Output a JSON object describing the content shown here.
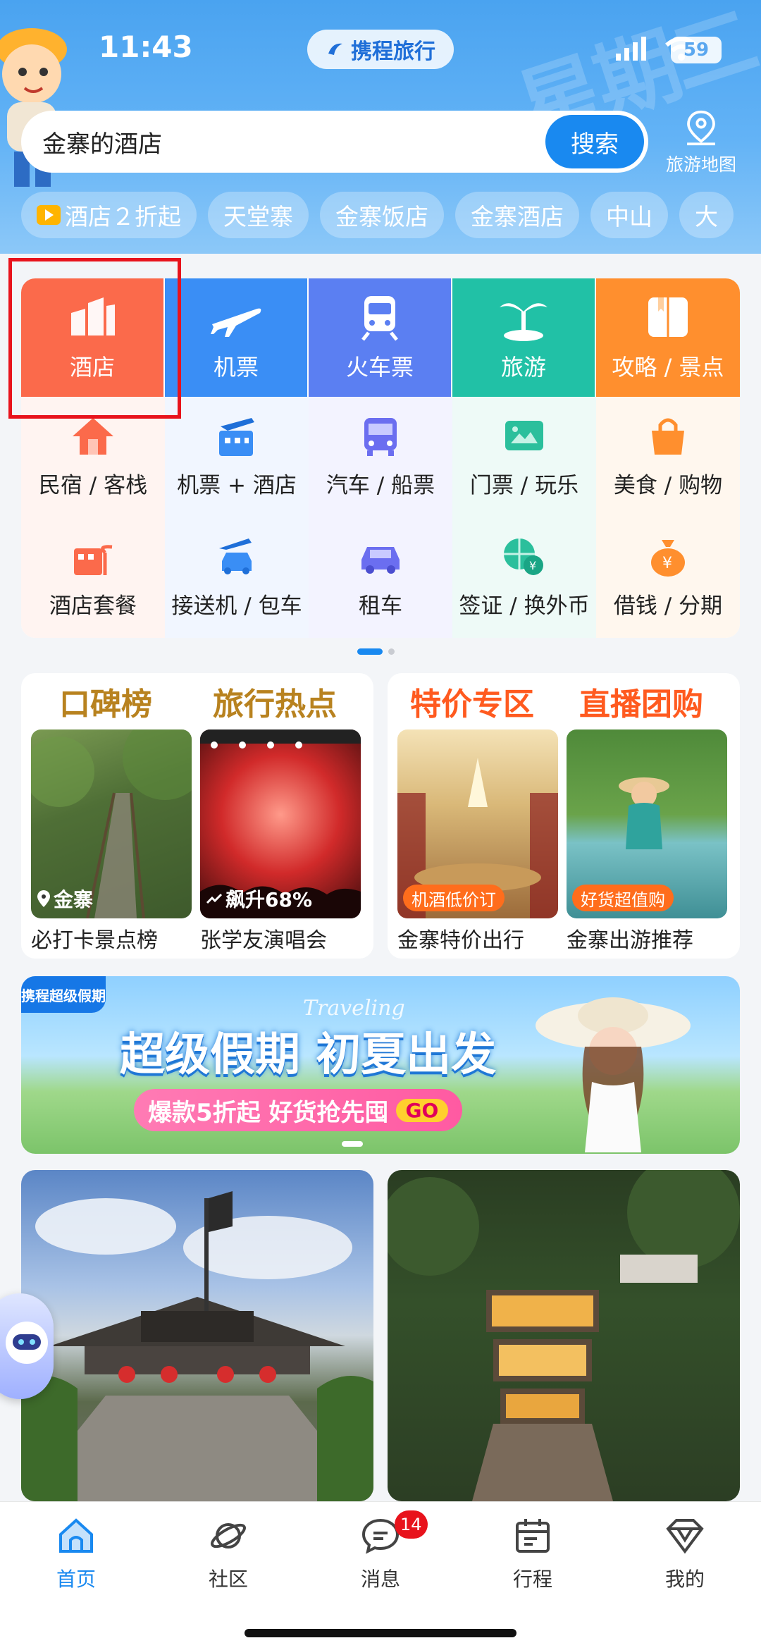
{
  "status_bar": {
    "time": "11:43",
    "battery": "59",
    "app_logo_text": "携程旅行"
  },
  "search": {
    "value": "金寨的酒店",
    "button_label": "搜索"
  },
  "map_button": {
    "label": "旅游地图",
    "icon": "map-pin-icon"
  },
  "chips": [
    {
      "label": "酒店２折起",
      "icon": "play-icon"
    },
    {
      "label": "天堂寨"
    },
    {
      "label": "金寨饭店"
    },
    {
      "label": "金寨酒店"
    },
    {
      "label": "中山"
    },
    {
      "label": "大"
    }
  ],
  "main_services": [
    {
      "label": "酒店",
      "icon": "hotel-icon",
      "color": "#fb6a4b"
    },
    {
      "label": "机票",
      "icon": "plane-icon",
      "color": "#3a8ef5"
    },
    {
      "label": "火车票",
      "icon": "train-icon",
      "color": "#5b7ff2"
    },
    {
      "label": "旅游",
      "icon": "palm-tree-icon",
      "color": "#21c1a6"
    },
    {
      "label": "攻略 / 景点",
      "icon": "book-icon",
      "color": "#ff8f2e"
    }
  ],
  "sub_services_row1": [
    {
      "label": "民宿 / 客栈",
      "icon": "house-icon"
    },
    {
      "label": "机票 + 酒店",
      "icon": "plane-hotel-icon"
    },
    {
      "label": "汽车 / 船票",
      "icon": "bus-icon"
    },
    {
      "label": "门票 / 玩乐",
      "icon": "ticket-icon"
    },
    {
      "label": "美食 / 购物",
      "icon": "shopping-bag-icon"
    }
  ],
  "sub_services_row2": [
    {
      "label": "酒店套餐",
      "icon": "hotel-package-icon"
    },
    {
      "label": "接送机 / 包车",
      "icon": "car-plane-icon"
    },
    {
      "label": "租车",
      "icon": "car-icon"
    },
    {
      "label": "签证 / 换外币",
      "icon": "globe-currency-icon"
    },
    {
      "label": "借钱 / 分期",
      "icon": "money-bag-icon"
    }
  ],
  "feature_left": {
    "heads": [
      "口碑榜",
      "旅行热点"
    ],
    "head_color": "#b8821f",
    "tiles": [
      {
        "tag": "金寨",
        "caption": "必打卡景点榜"
      },
      {
        "tag": "飙升68%",
        "caption": "张学友演唱会"
      }
    ]
  },
  "feature_right": {
    "heads": [
      "特价专区",
      "直播团购"
    ],
    "head_color": "#ff5a1f",
    "tiles": [
      {
        "tag": "机酒低价订",
        "caption": "金寨特价出行"
      },
      {
        "tag": "好货超值购",
        "caption": "金寨出游推荐"
      }
    ]
  },
  "banner": {
    "badge": "携程超级假期",
    "title": "超级假期 初夏出发",
    "script": "Traveling",
    "sub": "爆款5折起 好货抢先囤",
    "go": "GO"
  },
  "tabs": [
    {
      "label": "首页",
      "icon": "home-icon",
      "active": true
    },
    {
      "label": "社区",
      "icon": "planet-icon"
    },
    {
      "label": "消息",
      "icon": "message-icon",
      "badge": "14"
    },
    {
      "label": "行程",
      "icon": "calendar-icon"
    },
    {
      "label": "我的",
      "icon": "diamond-icon"
    }
  ],
  "colors": {
    "accent": "#1989f0",
    "highlight_box": "#e8131c"
  }
}
